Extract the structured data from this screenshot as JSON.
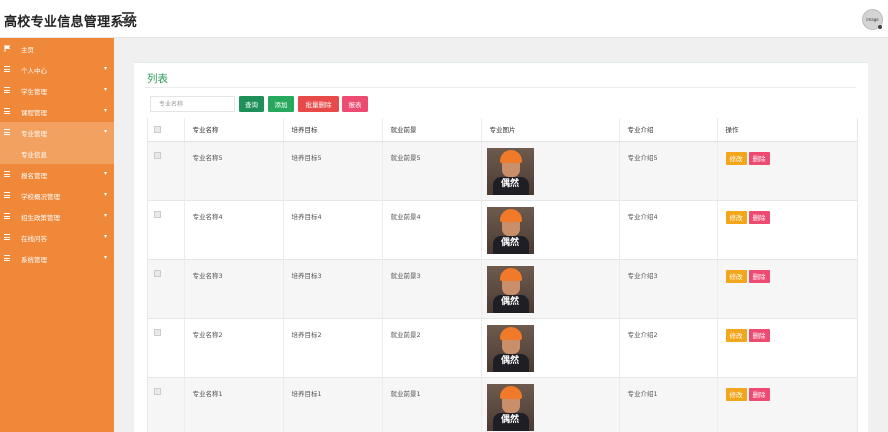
{
  "app": {
    "title": "高校专业信息管理系统",
    "avatar_text": "image"
  },
  "sidebar": {
    "items": [
      {
        "label": "主页",
        "icon": "flag-icon",
        "active": false,
        "has_arrow": false
      },
      {
        "label": "个人中心",
        "icon": "grid-icon",
        "active": false,
        "has_arrow": true
      },
      {
        "label": "学生管理",
        "icon": "grid-icon",
        "active": false,
        "has_arrow": true
      },
      {
        "label": "课程管理",
        "icon": "grid-icon",
        "active": false,
        "has_arrow": true
      },
      {
        "label": "专业管理",
        "icon": "grid-icon",
        "active": true,
        "has_arrow": true,
        "sub": "专业信息"
      },
      {
        "label": "报名管理",
        "icon": "grid-icon",
        "active": false,
        "has_arrow": true
      },
      {
        "label": "学校概况管理",
        "icon": "grid-icon",
        "active": false,
        "has_arrow": true
      },
      {
        "label": "招生政策管理",
        "icon": "grid-icon",
        "active": false,
        "has_arrow": true
      },
      {
        "label": "在线问答",
        "icon": "grid-icon",
        "active": false,
        "has_arrow": true
      },
      {
        "label": "系统管理",
        "icon": "grid-icon",
        "active": false,
        "has_arrow": true
      }
    ]
  },
  "main": {
    "title": "列表",
    "search": {
      "placeholder": "专业名称",
      "value": ""
    },
    "buttons": {
      "search": "查询",
      "add": "添加",
      "batch_delete": "批量删除",
      "report": "报表"
    },
    "table": {
      "headers": [
        "专业名称",
        "培养目标",
        "就业前景",
        "专业图片",
        "专业介绍",
        "操作"
      ],
      "rows": [
        {
          "name": "专业名称5",
          "goal": "培养目标5",
          "prospect": "就业前景5",
          "image_caption": "偶然",
          "intro": "专业介绍5"
        },
        {
          "name": "专业名称4",
          "goal": "培养目标4",
          "prospect": "就业前景4",
          "image_caption": "偶然",
          "intro": "专业介绍4"
        },
        {
          "name": "专业名称3",
          "goal": "培养目标3",
          "prospect": "就业前景3",
          "image_caption": "偶然",
          "intro": "专业介绍3"
        },
        {
          "name": "专业名称2",
          "goal": "培养目标2",
          "prospect": "就业前景2",
          "image_caption": "偶然",
          "intro": "专业介绍2"
        },
        {
          "name": "专业名称1",
          "goal": "培养目标1",
          "prospect": "就业前景1",
          "image_caption": "偶然",
          "intro": "专业介绍1"
        }
      ],
      "op_edit": "修改",
      "op_delete": "删除"
    }
  },
  "colors": {
    "sidebar": "#f0883a",
    "sidebar_active": "#f3a161",
    "accent_green": "#2e9c5c",
    "edit": "#f2a61c",
    "delete": "#ee4b72"
  }
}
